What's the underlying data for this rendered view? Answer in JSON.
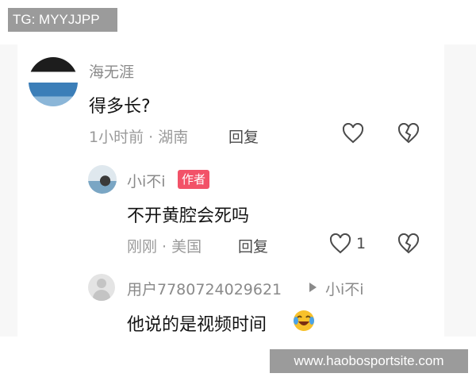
{
  "watermark_top": "TG: MYYJJPP",
  "watermark_bottom": "www.haobosportsite.com",
  "comment": {
    "username": "海无涯",
    "text": "得多长?",
    "meta": "1小时前 · 湖南",
    "reply_label": "回复"
  },
  "reply": {
    "username": "小i不i",
    "author_tag": "作者",
    "text": "不开黄腔会死吗",
    "meta": "刚刚 · 美国",
    "reply_label": "回复",
    "like_count": "1"
  },
  "subreply": {
    "username": "用户7780724029621",
    "reply_to": "小i不i",
    "text": "他说的是视频时间",
    "emoji": "laughing-crying-emoji"
  },
  "colors": {
    "author_tag": "#f25268",
    "watermark_bg": "#9b9b9b",
    "meta_text": "#9a9a9a"
  }
}
